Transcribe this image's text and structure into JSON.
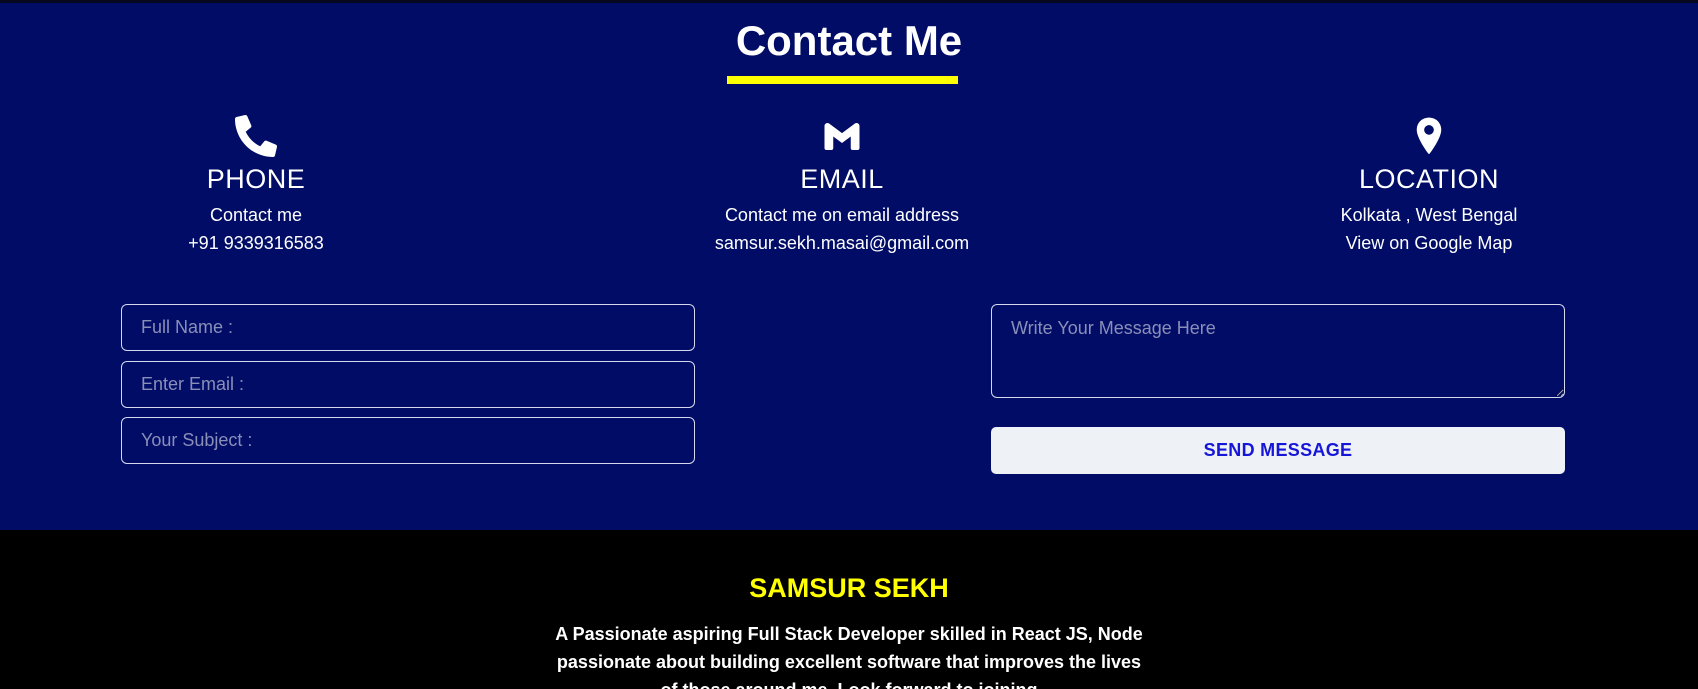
{
  "contact": {
    "heading": "Contact Me",
    "accent_color": "#ffff00",
    "background_color": "#000c66",
    "phone": {
      "icon": "phone-icon",
      "label": "PHONE",
      "line1": "Contact me",
      "line2": "+91 9339316583"
    },
    "email": {
      "icon": "gmail-icon",
      "label": "EMAIL",
      "line1": "Contact me on email address",
      "line2": "samsur.sekh.masai@gmail.com"
    },
    "location": {
      "icon": "map-pin-icon",
      "label": "LOCATION",
      "line1": "Kolkata , West Bengal",
      "line2": "View on Google Map"
    }
  },
  "form": {
    "name_placeholder": "Full Name :",
    "email_placeholder": "Enter Email :",
    "subject_placeholder": "Your Subject :",
    "message_placeholder": "Write Your Message Here",
    "send_label": "SEND MESSAGE"
  },
  "footer": {
    "name": "SAMSUR SEKH",
    "bio": "A Passionate aspiring Full Stack Developer skilled in React JS, Node passionate about building excellent software that improves the lives of those around me. Look forward to joining"
  }
}
